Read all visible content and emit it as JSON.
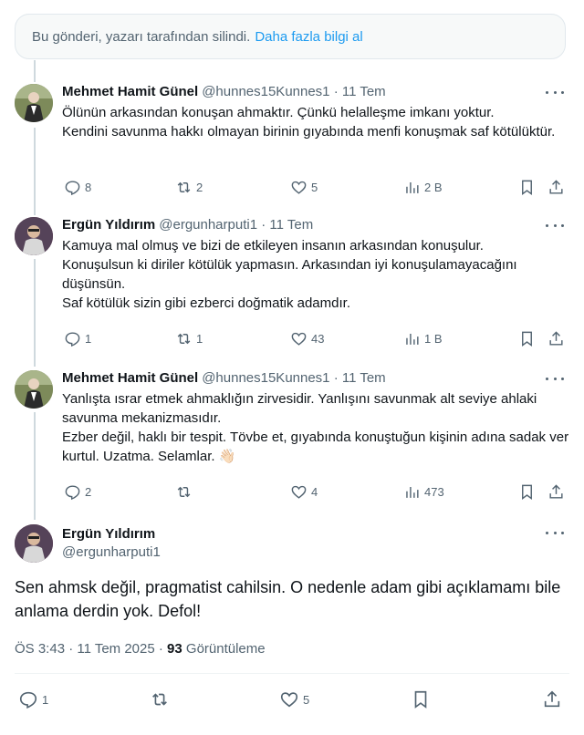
{
  "notice": {
    "text": "Bu gönderi, yazarı tarafından silindi.",
    "link": "Daha fazla bilgi al"
  },
  "replies": [
    {
      "name": "Mehmet Hamit Günel",
      "handle_time": "@hunnes15Kunnes1 · 11 Tem",
      "text": "Ölünün arkasından konuşan ahmaktır. Çünkü helalleşme imkanı yoktur.\nKendini savunma hakkı olmayan birinin gıyabında menfi konuşmak saf kötülüktür.",
      "replies": "8",
      "reposts": "2",
      "likes": "5",
      "views": "2 B"
    },
    {
      "name": "Ergün Yıldırım",
      "handle_time": "@ergunharputi1 · 11 Tem",
      "text": "Kamuya mal olmuş ve bizi de etkileyen insanın arkasından konuşulur.\nKonuşulsun ki diriler kötülük yapmasın. Arkasından iyi konuşulamayacağını düşünsün.\nSaf kötülük sizin gibi ezberci doğmatik adamdır.",
      "replies": "1",
      "reposts": "1",
      "likes": "43",
      "views": "1 B"
    },
    {
      "name": "Mehmet Hamit Günel",
      "handle_time": "@hunnes15Kunnes1 · 11 Tem",
      "text": "Yanlışta ısrar etmek ahmaklığın zirvesidir.  Yanlışını savunmak alt seviye ahlaki savunma mekanizmasıdır.\nEzber değil, haklı bir tespit. Tövbe et, gıyabında konuştuğun kişinin adına sadak ver kurtul. Uzatma. Selamlar. 👋🏻",
      "replies": "2",
      "reposts": "",
      "likes": "4",
      "views": "473"
    }
  ],
  "main_post": {
    "name": "Ergün Yıldırım",
    "handle": "@ergunharputi1",
    "text": "Sen ahmsk değil, pragmatist cahilsin. O nedenle adam gibi açıklamamı bile anlama derdin yok. Defol!",
    "time": "ÖS 3:43 · 11 Tem 2025 · ",
    "views_count": "93",
    "views_label": " Görüntüleme",
    "replies": "1",
    "likes": "5"
  },
  "icons": [
    "reply-icon",
    "repost-icon",
    "like-icon",
    "views-icon",
    "bookmark-icon",
    "share-icon",
    "more-icon"
  ],
  "colors": {
    "link": "#1d9bf0",
    "secondary": "#536471",
    "text": "#0f1419"
  }
}
